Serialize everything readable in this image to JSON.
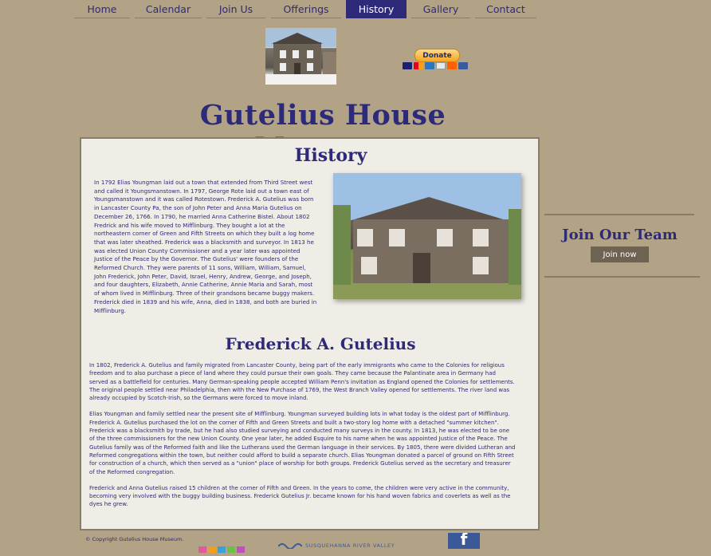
{
  "nav": {
    "items": [
      {
        "label": "Home"
      },
      {
        "label": "Calendar"
      },
      {
        "label": "Join Us"
      },
      {
        "label": "Offerings"
      },
      {
        "label": "History"
      },
      {
        "label": "Gallery"
      },
      {
        "label": "Contact"
      }
    ],
    "active": "History"
  },
  "donate": {
    "label": "Donate"
  },
  "site_title": "Gutelius House Museum",
  "history": {
    "heading": "History",
    "text": "In 1792 Elias Youngman laid out a town that extended from Third Street west and called it Youngsmanstown.  In 1797, George Rote laid out a town east of Youngsmanstown and it was called Rotestown.  Frederick A. Gutelius was born in Lancaster County Pa, the son of John Peter and Anna Maria Gutelius on December 26, 1766.  In 1790, he married Anna Catherine Bistel.  About 1802 Fredrick and his wife moved to Mifflinburg.  They bought a lot at the northeastern corner of Green and Fifth Streets on which they built a log home that was later sheathed.  Frederick was a blacksmith and surveyor.  In 1813 he was elected Union County Commissioner and a year later was appointed Justice of the Peace by the Governor.  The Gutelius' were founders of the Reformed Church.  They were parents of 11 sons, William, William, Samuel, John Frederick, John Peter, David, Israel, Henry, Andrew, George, and Joseph, and four daughters, Elizabeth, Annie Catherine, Annie Maria and Sarah, most of whom lived in Mifflinburg.  Three of their grandsons became buggy makers.  Frederick died in 1839 and his wife, Anna, died in 1838, and both are buried in Mifflinburg."
  },
  "frederick": {
    "heading": "Frederick A. Gutelius",
    "paragraphs": [
      "In 1802, Frederick A. Gutelius and family migrated from Lancaster County, being part of the early immigrants who came to the Colonies for religious freedom and to also purchase a piece of land where they could pursue their own goals.  They came because the Palantinate area in Germany had served as a battlefield for centuries.  Many German-speaking people accepted William Penn's invitation as England opened the Colonies for settlements.  The original people settled near Philadelphia, then with the New Purchase of 1769, the West Branch Valley opened for settlements.  The river land was already occupied by Scotch-Irish, so the Germans were forced to move inland.",
      "Elias Youngman and family settled near the present site of Mifflinburg.  Youngman surveyed building lots in what today is the oldest part of Mifflinburg.  Frederick A. Gutelius purchased the lot on the corner of Fifth and Green Streets and built a two-story log home with a detached \"summer kitchen\".  Frederick was a blacksmith by trade, but he had also studied surveying and conducted many surveys in the county.  In 1813, he was elected to be one of the three commissioners for the new Union County.  One year later, he added Esquire to his name when he was appointed Justice of the Peace.  The Gutelius family was of the Reformed faith and like the Lutherans used the German language in their services.  By 1805, there were divided Lutheran and Reformed congregations within the town, but neither could afford to build a separate church.  Elias Youngman donated a parcel of ground on Fifth Street for construction of a church, which then served as a \"union\" place of worship for both groups.  Frederick Gutelius served as the secretary and treasurer of the Reformed congregation.",
      "Frederick and Anna Gutelius raised 15 children at the corner of Fifth and Green.  In the years to come, the children were very active in the community, becoming very involved with the buggy building business.  Frederick Gutelius Jr. became known for his hand woven fabrics and coverlets as well as the dyes he grew."
    ]
  },
  "join": {
    "heading": "Join Our Team",
    "button": "Join now"
  },
  "footer": {
    "copyright": "© Copyright Gutelius House Museum.",
    "partner_text": "SUSQUEHANNA RIVER VALLEY",
    "facebook_letter": "f"
  },
  "colors": {
    "background": "#b3a386",
    "accent": "#2e2a7a",
    "panel": "#f0ece6"
  }
}
